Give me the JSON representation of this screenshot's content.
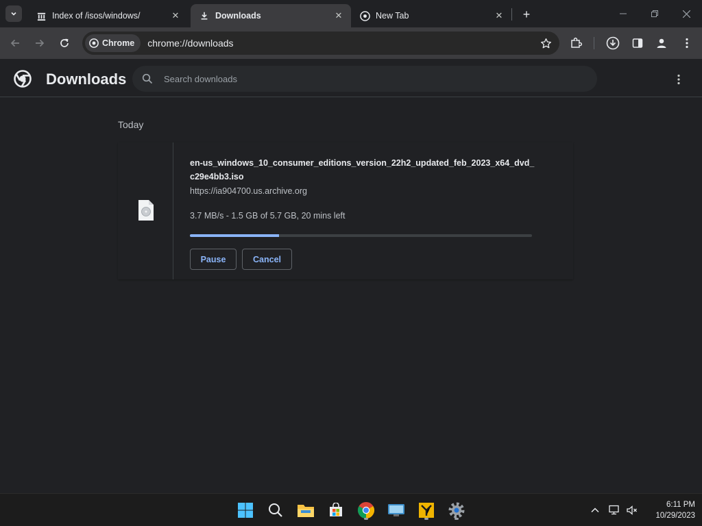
{
  "tabs": [
    {
      "title": "Index of /isos/windows/",
      "icon": "archive-icon"
    },
    {
      "title": "Downloads",
      "icon": "download-icon"
    },
    {
      "title": "New Tab",
      "icon": "chrome-icon"
    }
  ],
  "omnibox": {
    "chip_label": "Chrome",
    "url": "chrome://downloads"
  },
  "page": {
    "title": "Downloads",
    "search_placeholder": "Search downloads",
    "date_group": "Today"
  },
  "download": {
    "filename": "en-us_windows_10_consumer_editions_version_22h2_updated_feb_2023_x64_dvd_c29e4bb3.iso",
    "source": "https://ia904700.us.archive.org",
    "status": "3.7 MB/s - 1.5 GB of 5.7 GB, 20 mins left",
    "progress": 0.26,
    "pause_label": "Pause",
    "cancel_label": "Cancel"
  },
  "taskbar": {
    "apps": [
      "start-icon",
      "search-icon",
      "file-explorer-icon",
      "store-icon",
      "chrome-icon",
      "remote-desktop-icon",
      "tools-icon",
      "settings-icon"
    ],
    "time": "6:11 PM",
    "date": "10/29/2023"
  },
  "colors": {
    "accent": "#8ab4f8",
    "background": "#202124",
    "toolbar": "#3c3c3f"
  }
}
